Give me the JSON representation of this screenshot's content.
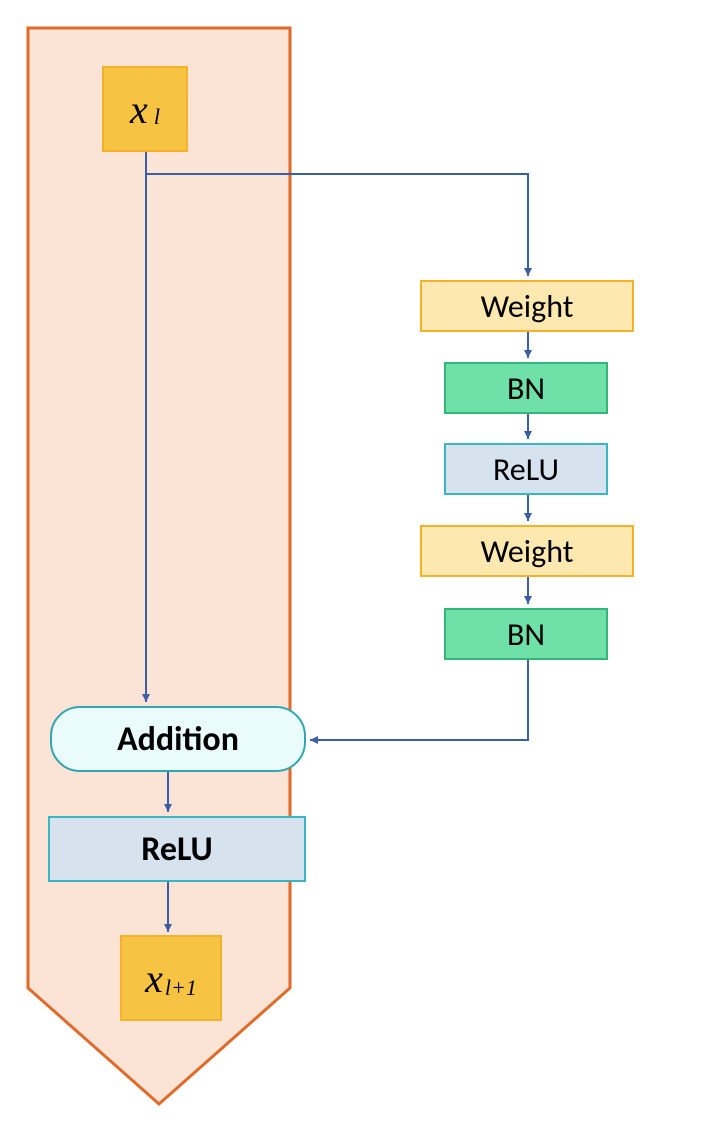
{
  "input": {
    "var": "x",
    "sub": "l"
  },
  "output": {
    "var": "x",
    "sub": "l+1"
  },
  "branch": {
    "weight1": "Weight",
    "bn1": "BN",
    "relu1": "ReLU",
    "weight2": "Weight",
    "bn2": "BN"
  },
  "main": {
    "addition": "Addition",
    "relu": "ReLU"
  },
  "colors": {
    "path_fill": "#fbe3d5",
    "path_stroke": "#e06a2a",
    "gold": "#f7c343",
    "gold_border": "#f3b22a",
    "weight_fill": "#fde9b0",
    "bn_fill": "#6fe0a8",
    "bn_border": "#33b57b",
    "relu_fill": "#d6e2ee",
    "relu_border": "#39b6c4",
    "addition_fill": "#e9fbfb",
    "addition_border": "#33a6b4",
    "arrow": "#3a5ea8"
  }
}
